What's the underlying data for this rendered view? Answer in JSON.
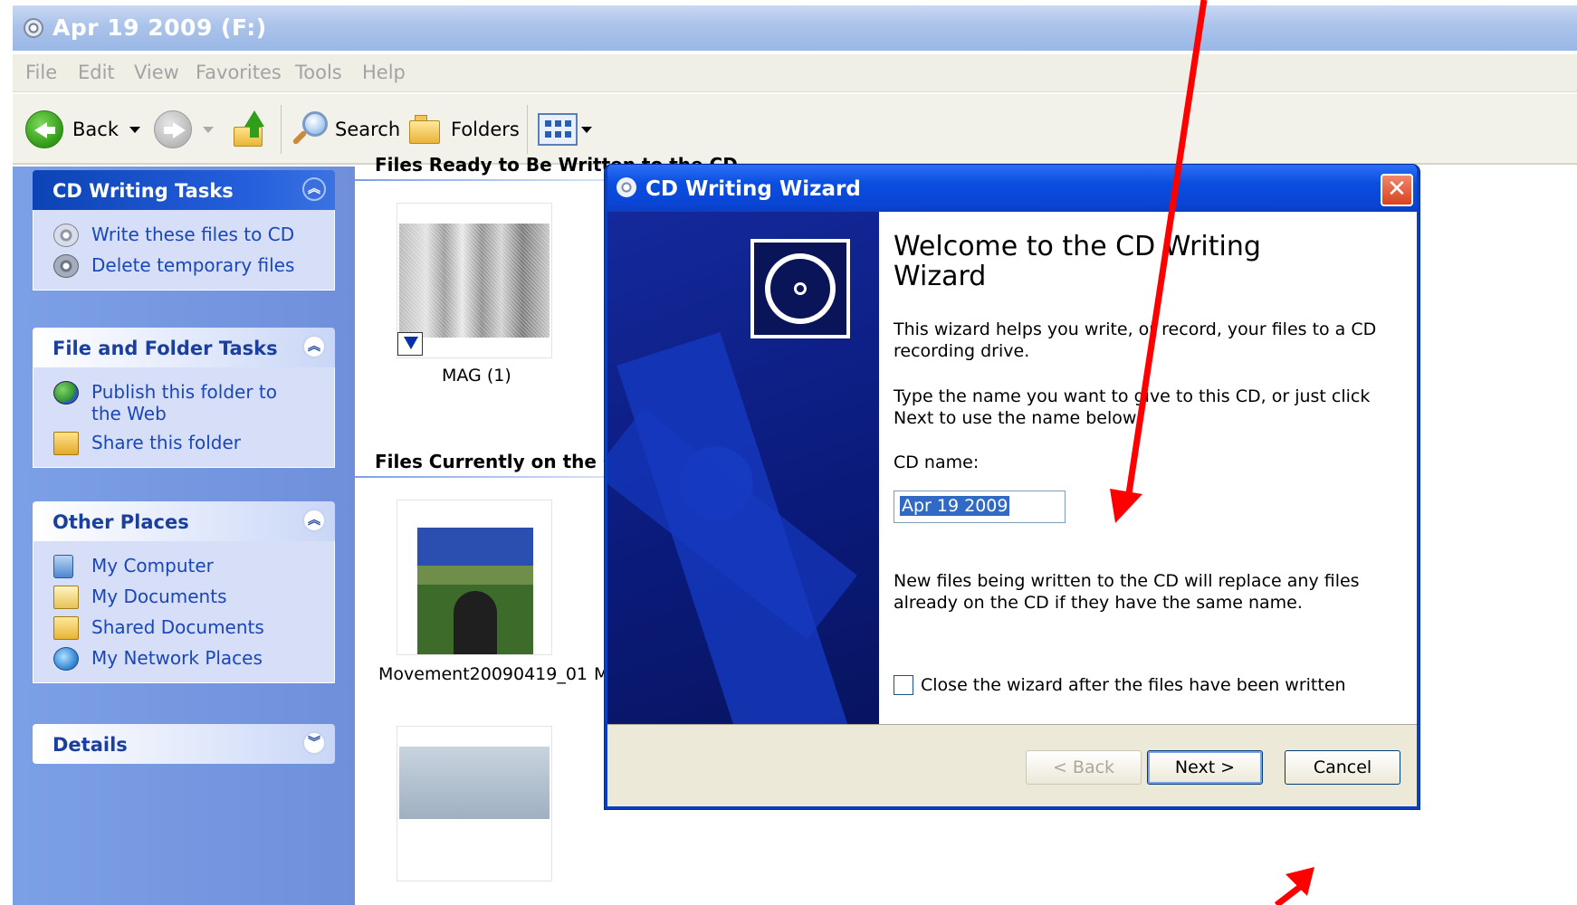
{
  "window": {
    "title": "Apr 19 2009 (F:)"
  },
  "menu": [
    "File",
    "Edit",
    "View",
    "Favorites",
    "Tools",
    "Help"
  ],
  "toolbar": {
    "back": "Back",
    "search": "Search",
    "folders": "Folders"
  },
  "sidebar": {
    "groups": [
      {
        "title": "CD Writing Tasks",
        "items": [
          "Write these files to CD",
          "Delete temporary files"
        ]
      },
      {
        "title": "File and Folder Tasks",
        "items": [
          "Publish this folder to the Web",
          "Share this folder"
        ]
      },
      {
        "title": "Other Places",
        "items": [
          "My Computer",
          "My Documents",
          "Shared Documents",
          "My Network Places"
        ]
      },
      {
        "title": "Details",
        "items": []
      }
    ]
  },
  "files": {
    "ready_header": "Files Ready to Be Written to the CD",
    "ready_items": [
      {
        "name": "MAG (1)"
      }
    ],
    "current_header": "Files Currently on the CD",
    "current_items": [
      {
        "name": "Movement20090419_01"
      },
      {
        "name": "Mo"
      }
    ]
  },
  "dialog": {
    "title": "CD Writing Wizard",
    "heading": "Welcome to the CD Writing Wizard",
    "paragraph1": "This wizard helps you write, or record, your files to a CD recording drive.",
    "paragraph2": "Type the name you want to give to this CD, or just click Next to use the name below.",
    "cd_name_label": "CD name:",
    "cd_name_value": "Apr 19 2009",
    "paragraph3": "New files being written to the CD will replace any files already on the CD if they have the same name.",
    "close_checkbox_label": "Close the wizard after the files have been written",
    "close_checkbox_checked": false,
    "buttons": {
      "back": "< Back",
      "next": "Next >",
      "cancel": "Cancel"
    }
  },
  "colors": {
    "xp_title_blue": "#0a4ee0",
    "task_pane_blue": "#7ca0e6",
    "annotation_red": "#ff0000"
  }
}
